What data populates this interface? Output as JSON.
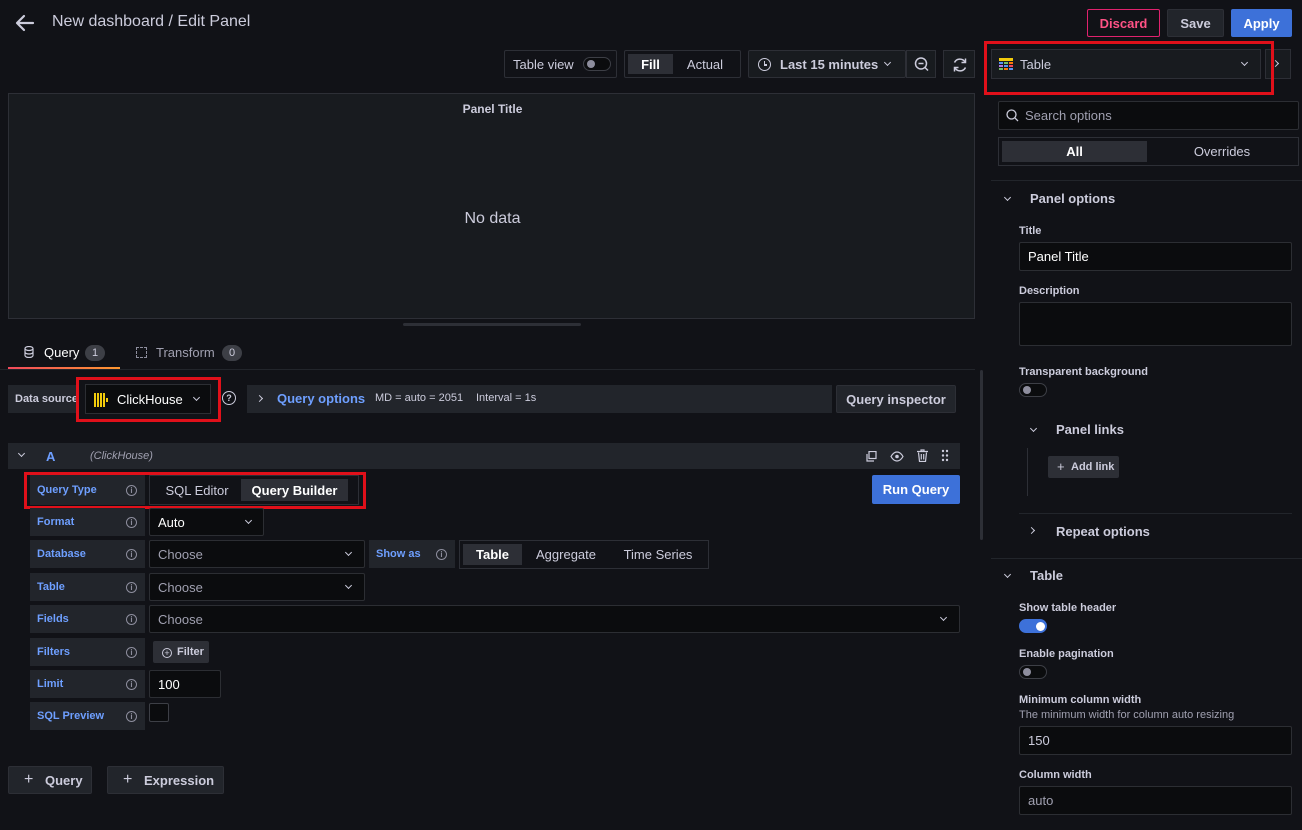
{
  "header": {
    "title": "New dashboard / Edit Panel",
    "discard_label": "Discard",
    "save_label": "Save",
    "apply_label": "Apply"
  },
  "toolbar": {
    "table_view_label": "Table view",
    "fill_label": "Fill",
    "actual_label": "Actual",
    "time_range": "Last 15 minutes"
  },
  "viz_picker": {
    "selected": "Table"
  },
  "panel": {
    "title": "Panel Title",
    "no_data": "No data"
  },
  "tabs": [
    {
      "label": "Query",
      "count": "1"
    },
    {
      "label": "Transform",
      "count": "0"
    }
  ],
  "datasource": {
    "label": "Data source",
    "selected": "ClickHouse",
    "query_options_label": "Query options",
    "md_text": "MD = auto = 2051",
    "interval_text": "Interval = 1s",
    "inspector_label": "Query inspector"
  },
  "query": {
    "ref_id": "A",
    "ds_name": "(ClickHouse)",
    "run_label": "Run Query",
    "query_type_label": "Query Type",
    "sql_editor_label": "SQL Editor",
    "query_builder_label": "Query Builder",
    "format_label": "Format",
    "format_value": "Auto",
    "database_label": "Database",
    "database_placeholder": "Choose",
    "show_as_label": "Show as",
    "show_as_options": [
      "Table",
      "Aggregate",
      "Time Series"
    ],
    "table_label": "Table",
    "table_placeholder": "Choose",
    "fields_label": "Fields",
    "fields_placeholder": "Choose",
    "filters_label": "Filters",
    "filter_button": "Filter",
    "limit_label": "Limit",
    "limit_value": "100",
    "sql_preview_label": "SQL Preview"
  },
  "bottom": {
    "add_query": "Query",
    "add_expression": "Expression"
  },
  "options": {
    "search_placeholder": "Search options",
    "tab_all": "All",
    "tab_overrides": "Overrides",
    "panel_options": "Panel options",
    "title_label": "Title",
    "title_value": "Panel Title",
    "description_label": "Description",
    "transparent_label": "Transparent background",
    "panel_links": "Panel links",
    "add_link": "Add link",
    "repeat_options": "Repeat options",
    "table_section": "Table",
    "show_header_label": "Show table header",
    "pagination_label": "Enable pagination",
    "min_width_label": "Minimum column width",
    "min_width_desc": "The minimum width for column auto resizing",
    "min_width_value": "150",
    "col_width_label": "Column width",
    "col_width_value": "auto"
  }
}
